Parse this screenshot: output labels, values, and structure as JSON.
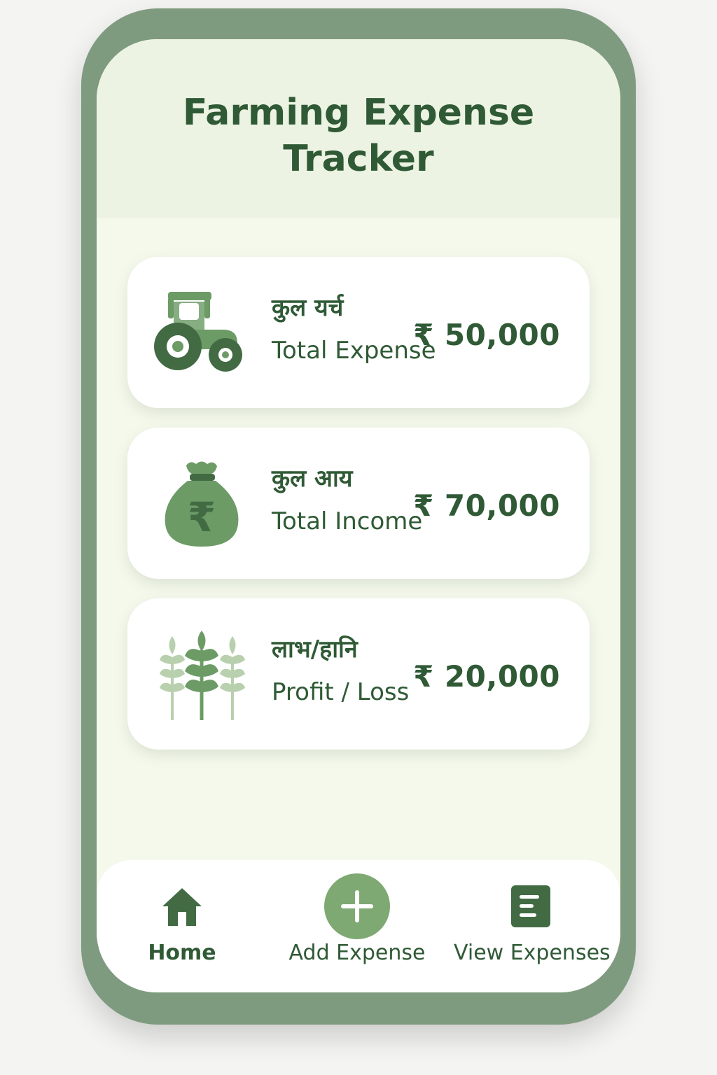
{
  "app": {
    "title_lines": [
      "Farming Expense",
      "Tracker"
    ]
  },
  "summary_cards": [
    {
      "icon": "tractor-icon",
      "hindi_label": "कुल यर्च",
      "english_label": "Total Expense",
      "amount": "₹ 50,000"
    },
    {
      "icon": "money-bag-icon",
      "hindi_label": "कुल आय",
      "english_label": "Total Income",
      "amount": "₹ 70,000"
    },
    {
      "icon": "wheat-icon",
      "hindi_label": "लाभ/हानि",
      "english_label": "Profit / Loss",
      "amount": "₹ 20,000"
    }
  ],
  "bottom_nav": {
    "items": [
      {
        "icon": "home-icon",
        "label": "Home"
      },
      {
        "icon": "plus-icon",
        "label": "Add Expense"
      },
      {
        "icon": "document-list-icon",
        "label": "View Expenses"
      }
    ]
  },
  "colors": {
    "accent": "#2f5a35",
    "phone_frame": "#7f9b7f",
    "icon_green": "#6c9b66",
    "light_green": "#b8d0ad",
    "card_background": "#ffffff",
    "screen_background": "#f5f9ec",
    "header_background": "#edf3e3"
  }
}
